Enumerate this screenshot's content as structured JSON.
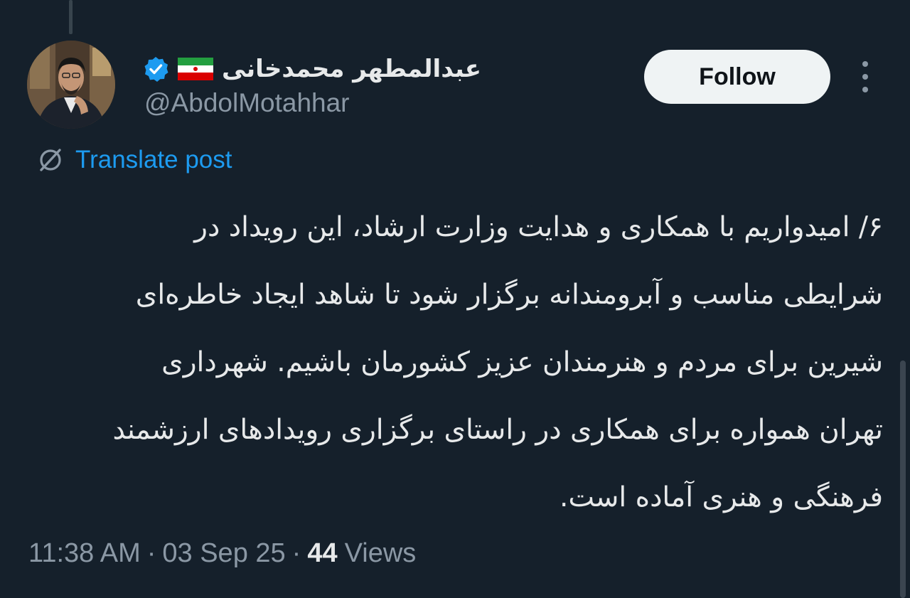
{
  "author": {
    "display_name": "عبدالمطهر محمدخانی",
    "handle": "@AbdolMotahhar",
    "verified_icon": "verified-badge-icon",
    "flag_icon": "iran-flag-icon"
  },
  "actions": {
    "follow_label": "Follow",
    "more_icon": "more-vertical-icon"
  },
  "translate": {
    "label": "Translate post",
    "icon": "translate-globe-icon"
  },
  "post": {
    "lines": [
      "۶/ امیدواریم با همکاری و هدایت وزارت ارشاد، این رویداد در",
      "شرایطی مناسب و آبرومندانه برگزار شود تا شاهد ایجاد خاطره‌ای",
      "شیرین برای مردم و هنرمندان عزیز کشورمان باشیم. شهرداری",
      "تهران همواره برای همکاری در راستای برگزاری رویدادهای ارزشمند",
      "فرهنگی و هنری آماده است."
    ]
  },
  "meta": {
    "time": "11:38 AM",
    "separator": "·",
    "date": "03 Sep 25",
    "views_count": "44",
    "views_label": "Views"
  },
  "colors": {
    "background": "#15202b",
    "primary_text": "#e7e9ea",
    "secondary_text": "#8b98a5",
    "link": "#1d9bf0",
    "verified": "#1d9bf0",
    "follow_bg": "#eff3f4"
  }
}
